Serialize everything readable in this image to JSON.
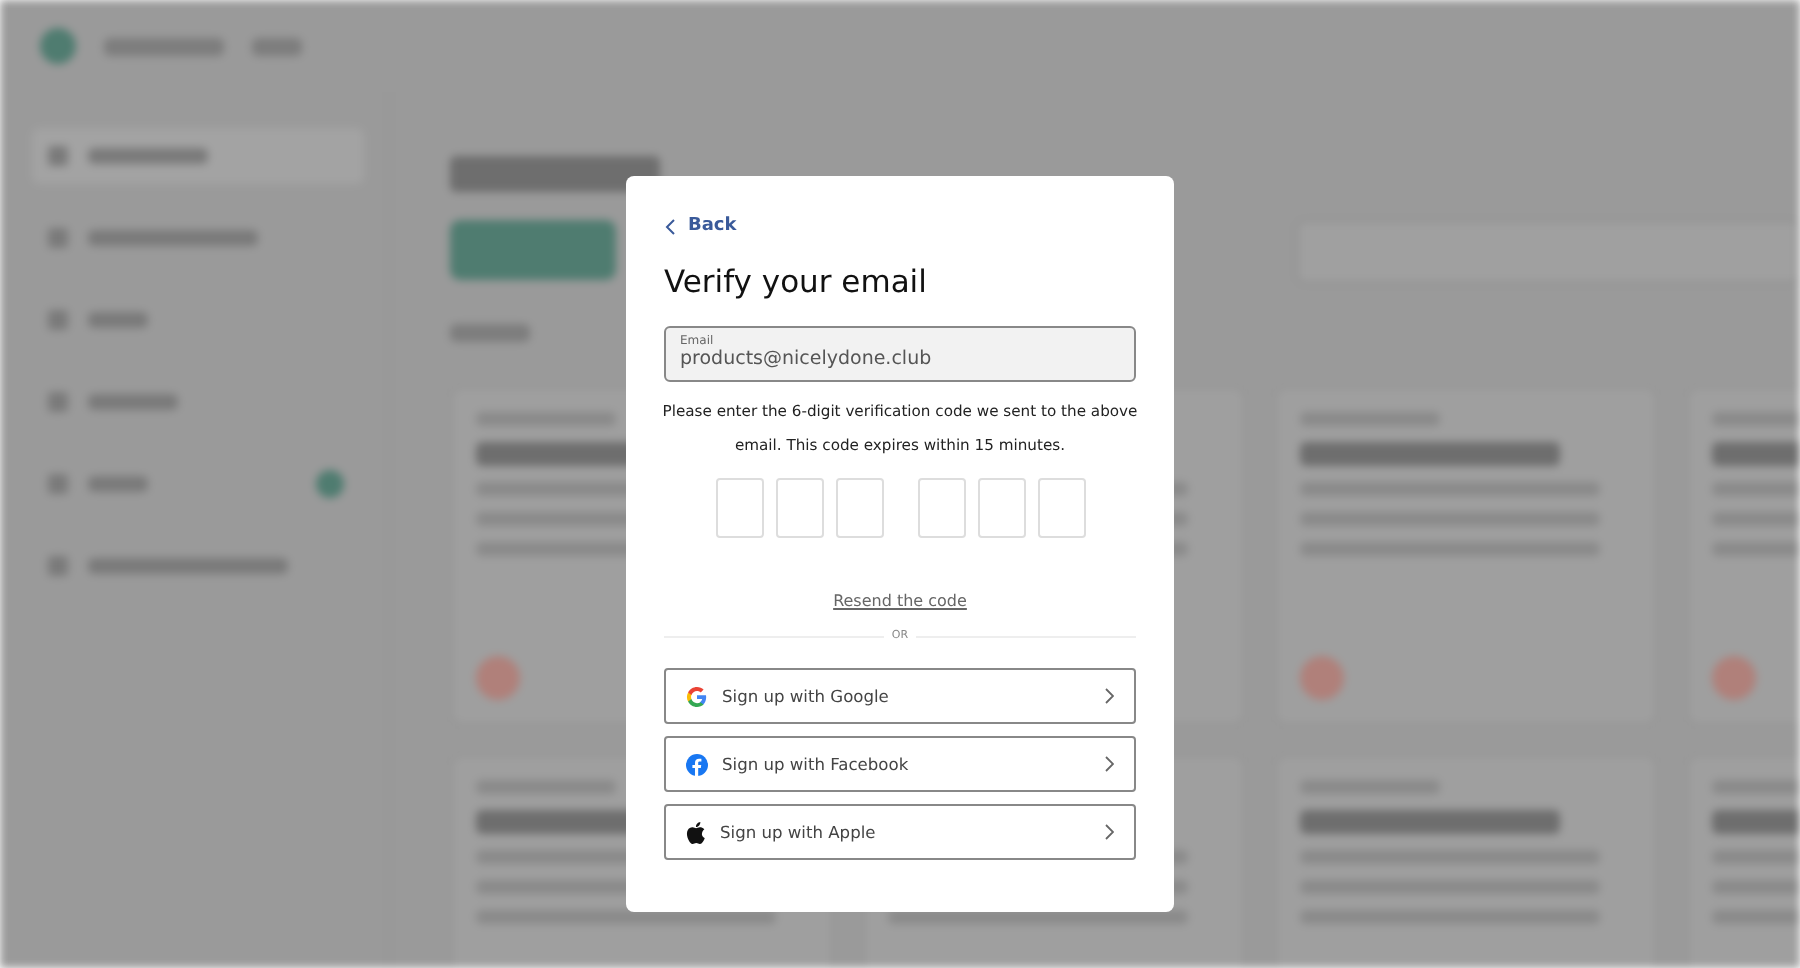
{
  "dialog": {
    "back": "Back",
    "title": "Verify your email",
    "email_field": {
      "label": "Email",
      "value": "products@nicelydone.club"
    },
    "instructions": "Please enter the 6-digit verification code we sent to the above email. This code expires within 15 minutes.",
    "code_boxes": [
      {
        "focused": false
      },
      {
        "focused": false
      },
      {
        "focused": false
      },
      {
        "focused": false
      },
      {
        "focused": false
      },
      {
        "focused": false
      }
    ],
    "resend": "Resend the code",
    "divider": "OR",
    "providers": [
      {
        "kind": "google",
        "label": "Sign up with Google"
      },
      {
        "kind": "facebook",
        "label": "Sign up with Facebook"
      },
      {
        "kind": "apple",
        "label": "Sign up with Apple"
      }
    ]
  }
}
